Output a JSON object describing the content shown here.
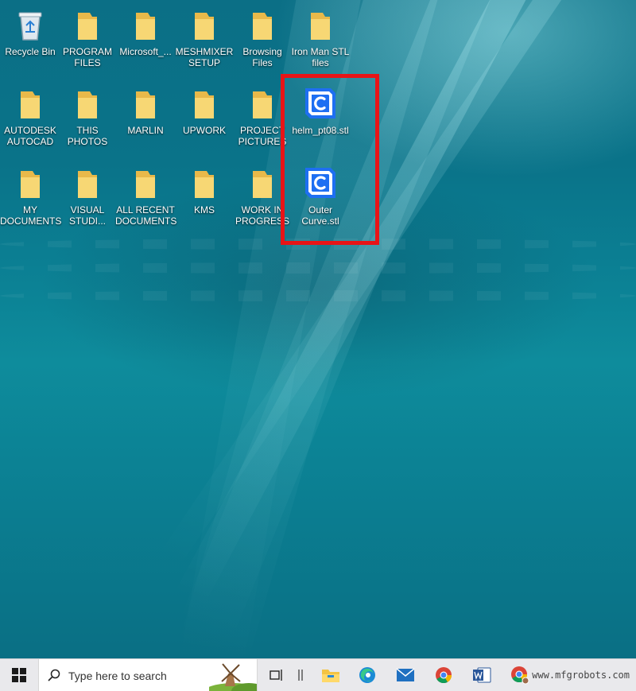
{
  "desktop": {
    "icons_row1": [
      {
        "label": "Recycle Bin",
        "icon": "recycle-bin-icon"
      },
      {
        "label": "PROGRAM\nFILES",
        "icon": "folder-icon"
      },
      {
        "label": "Microsoft_...",
        "icon": "folder-icon"
      },
      {
        "label": "MESHMIXER\nSETUP",
        "icon": "folder-icon"
      },
      {
        "label": "Browsing\nFiles",
        "icon": "folder-icon"
      },
      {
        "label": "Iron Man STL\nfiles",
        "icon": "folder-icon"
      }
    ],
    "icons_row2": [
      {
        "label": "AUTODESK\nAUTOCAD",
        "icon": "folder-icon"
      },
      {
        "label": "THIS PHOTOS",
        "icon": "folder-icon"
      },
      {
        "label": "MARLIN",
        "icon": "folder-icon"
      },
      {
        "label": "UPWORK",
        "icon": "folder-icon"
      },
      {
        "label": "PROJECT\nPICTURES",
        "icon": "folder-icon"
      },
      {
        "label": "helm_pt08.stl",
        "icon": "cura-file-icon"
      }
    ],
    "icons_row3": [
      {
        "label": "MY\nDOCUMENTS",
        "icon": "folder-icon"
      },
      {
        "label": "VISUAL\nSTUDI...",
        "icon": "folder-icon"
      },
      {
        "label": "ALL RECENT\nDOCUMENTS",
        "icon": "folder-icon"
      },
      {
        "label": "KMS",
        "icon": "folder-icon"
      },
      {
        "label": "WORK IN\nPROGRESS",
        "icon": "folder-icon"
      },
      {
        "label": "Outer\nCurve.stl",
        "icon": "cura-file-icon"
      }
    ],
    "highlight_color": "#e81417"
  },
  "taskbar": {
    "search_placeholder": "Type here to search",
    "apps": [
      "windows-start-icon",
      "search-icon",
      "task-view-icon",
      "file-explorer-icon",
      "edge-icon",
      "mail-icon",
      "chrome-icon",
      "word-icon",
      "chrome-profile-icon"
    ],
    "watermark": "www.mfgrobots.com"
  },
  "colors": {
    "folder": "#f7d774",
    "cura_blue": "#1e6ff2",
    "taskbar_bg": "#e9e9ec"
  }
}
